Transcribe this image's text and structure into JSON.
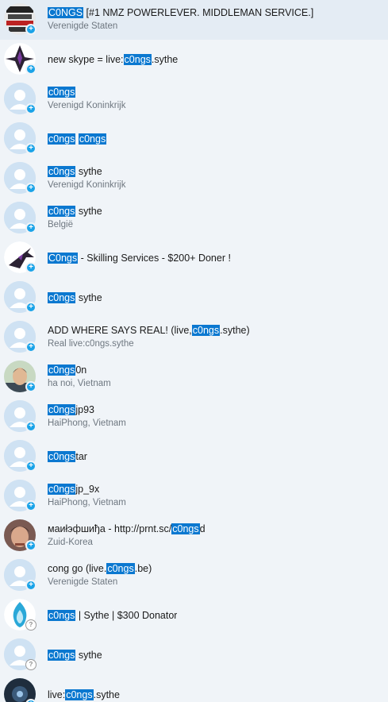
{
  "results": [
    {
      "parts": [
        {
          "t": "C0NGS",
          "hl": true
        },
        {
          "t": " [#1 NMZ POWERLEVER. MIDDLEMAN SERVICE.]"
        }
      ],
      "sub": "Verenigde Staten",
      "avatar": "logo-tile",
      "badge": "add"
    },
    {
      "parts": [
        {
          "t": "new skype = live:"
        },
        {
          "t": "c0ngs",
          "hl": true
        },
        {
          "t": ".sythe"
        }
      ],
      "sub": "",
      "avatar": "emblem-dark",
      "badge": "add"
    },
    {
      "parts": [
        {
          "t": "c0ngs",
          "hl": true
        }
      ],
      "sub": "Verenigd Koninkrijk",
      "avatar": "default",
      "badge": "add"
    },
    {
      "parts": [
        {
          "t": "c0ngs",
          "hl": true
        },
        {
          "t": " "
        },
        {
          "t": "c0ngs",
          "hl": true
        }
      ],
      "sub": "",
      "avatar": "default",
      "badge": "add"
    },
    {
      "parts": [
        {
          "t": "c0ngs",
          "hl": true
        },
        {
          "t": " sythe"
        }
      ],
      "sub": "Verenigd Koninkrijk",
      "avatar": "default",
      "badge": "add"
    },
    {
      "parts": [
        {
          "t": "c0ngs",
          "hl": true
        },
        {
          "t": " sythe"
        }
      ],
      "sub": "België",
      "avatar": "default",
      "badge": "add"
    },
    {
      "parts": [
        {
          "t": "C0ngs",
          "hl": true
        },
        {
          "t": " - Skilling Services - $200+ Doner !"
        }
      ],
      "sub": "",
      "avatar": "emblem-light",
      "badge": "add"
    },
    {
      "parts": [
        {
          "t": "c0ngs",
          "hl": true
        },
        {
          "t": " sythe"
        }
      ],
      "sub": "",
      "avatar": "default",
      "badge": "add"
    },
    {
      "parts": [
        {
          "t": "ADD WHERE SAYS REAL! (live,"
        },
        {
          "t": "c0ngs",
          "hl": true
        },
        {
          "t": ".sythe)"
        }
      ],
      "sub": "Real live:c0ngs.sythe",
      "avatar": "default",
      "badge": "add"
    },
    {
      "parts": [
        {
          "t": "c0ngs",
          "hl": true
        },
        {
          "t": "0n"
        }
      ],
      "sub": "ha noi, Vietnam",
      "avatar": "photo-man",
      "badge": "add"
    },
    {
      "parts": [
        {
          "t": "c0ngs",
          "hl": true
        },
        {
          "t": "jp93"
        }
      ],
      "sub": "HaiPhong, Vietnam",
      "avatar": "default",
      "badge": "add"
    },
    {
      "parts": [
        {
          "t": "c0ngs",
          "hl": true
        },
        {
          "t": "tar"
        }
      ],
      "sub": "",
      "avatar": "default",
      "badge": "add"
    },
    {
      "parts": [
        {
          "t": "c0ngs",
          "hl": true
        },
        {
          "t": "jp_9x"
        }
      ],
      "sub": "HaiPhong, Vietnam",
      "avatar": "default",
      "badge": "add"
    },
    {
      "parts": [
        {
          "t": "маиłэфшиђа - http://prnt.sc/"
        },
        {
          "t": "c0ngs",
          "hl": true
        },
        {
          "t": "d"
        }
      ],
      "sub": "Zuid-Korea",
      "avatar": "photo-face",
      "badge": "add"
    },
    {
      "parts": [
        {
          "t": "cong go (live."
        },
        {
          "t": "c0ngs",
          "hl": true
        },
        {
          "t": ".be)"
        }
      ],
      "sub": "Verenigde Staten",
      "avatar": "default",
      "badge": "add"
    },
    {
      "parts": [
        {
          "t": "c0ngs",
          "hl": true
        },
        {
          "t": " | Sythe | $300 Donator"
        }
      ],
      "sub": "",
      "avatar": "flame",
      "badge": "unknown"
    },
    {
      "parts": [
        {
          "t": "c0ngs",
          "hl": true
        },
        {
          "t": " sythe"
        }
      ],
      "sub": "",
      "avatar": "default",
      "badge": "unknown"
    },
    {
      "parts": [
        {
          "t": "live:"
        },
        {
          "t": "c0ngs",
          "hl": true
        },
        {
          "t": ".sythe"
        }
      ],
      "sub": "",
      "avatar": "dark-round",
      "badge": "add"
    }
  ],
  "badge_symbols": {
    "add": "+",
    "unknown": "?"
  },
  "colors": {
    "highlight": "#0b78d0",
    "badge_add": "#1aa3e8",
    "background": "#f0f4f8",
    "default_avatar": "#cfe2f3"
  }
}
